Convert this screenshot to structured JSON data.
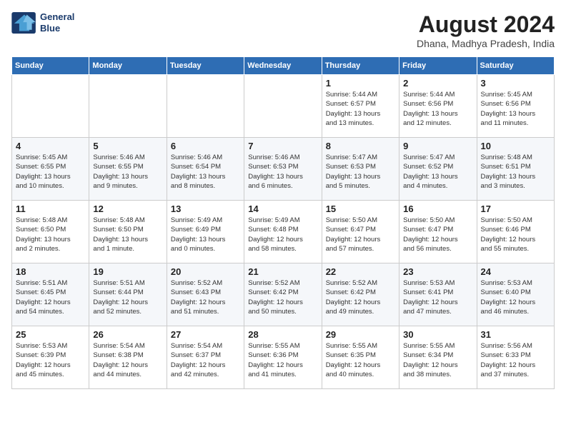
{
  "header": {
    "logo_line1": "General",
    "logo_line2": "Blue",
    "month_year": "August 2024",
    "location": "Dhana, Madhya Pradesh, India"
  },
  "weekdays": [
    "Sunday",
    "Monday",
    "Tuesday",
    "Wednesday",
    "Thursday",
    "Friday",
    "Saturday"
  ],
  "weeks": [
    [
      {
        "day": "",
        "info": ""
      },
      {
        "day": "",
        "info": ""
      },
      {
        "day": "",
        "info": ""
      },
      {
        "day": "",
        "info": ""
      },
      {
        "day": "1",
        "info": "Sunrise: 5:44 AM\nSunset: 6:57 PM\nDaylight: 13 hours\nand 13 minutes."
      },
      {
        "day": "2",
        "info": "Sunrise: 5:44 AM\nSunset: 6:56 PM\nDaylight: 13 hours\nand 12 minutes."
      },
      {
        "day": "3",
        "info": "Sunrise: 5:45 AM\nSunset: 6:56 PM\nDaylight: 13 hours\nand 11 minutes."
      }
    ],
    [
      {
        "day": "4",
        "info": "Sunrise: 5:45 AM\nSunset: 6:55 PM\nDaylight: 13 hours\nand 10 minutes."
      },
      {
        "day": "5",
        "info": "Sunrise: 5:46 AM\nSunset: 6:55 PM\nDaylight: 13 hours\nand 9 minutes."
      },
      {
        "day": "6",
        "info": "Sunrise: 5:46 AM\nSunset: 6:54 PM\nDaylight: 13 hours\nand 8 minutes."
      },
      {
        "day": "7",
        "info": "Sunrise: 5:46 AM\nSunset: 6:53 PM\nDaylight: 13 hours\nand 6 minutes."
      },
      {
        "day": "8",
        "info": "Sunrise: 5:47 AM\nSunset: 6:53 PM\nDaylight: 13 hours\nand 5 minutes."
      },
      {
        "day": "9",
        "info": "Sunrise: 5:47 AM\nSunset: 6:52 PM\nDaylight: 13 hours\nand 4 minutes."
      },
      {
        "day": "10",
        "info": "Sunrise: 5:48 AM\nSunset: 6:51 PM\nDaylight: 13 hours\nand 3 minutes."
      }
    ],
    [
      {
        "day": "11",
        "info": "Sunrise: 5:48 AM\nSunset: 6:50 PM\nDaylight: 13 hours\nand 2 minutes."
      },
      {
        "day": "12",
        "info": "Sunrise: 5:48 AM\nSunset: 6:50 PM\nDaylight: 13 hours\nand 1 minute."
      },
      {
        "day": "13",
        "info": "Sunrise: 5:49 AM\nSunset: 6:49 PM\nDaylight: 13 hours\nand 0 minutes."
      },
      {
        "day": "14",
        "info": "Sunrise: 5:49 AM\nSunset: 6:48 PM\nDaylight: 12 hours\nand 58 minutes."
      },
      {
        "day": "15",
        "info": "Sunrise: 5:50 AM\nSunset: 6:47 PM\nDaylight: 12 hours\nand 57 minutes."
      },
      {
        "day": "16",
        "info": "Sunrise: 5:50 AM\nSunset: 6:47 PM\nDaylight: 12 hours\nand 56 minutes."
      },
      {
        "day": "17",
        "info": "Sunrise: 5:50 AM\nSunset: 6:46 PM\nDaylight: 12 hours\nand 55 minutes."
      }
    ],
    [
      {
        "day": "18",
        "info": "Sunrise: 5:51 AM\nSunset: 6:45 PM\nDaylight: 12 hours\nand 54 minutes."
      },
      {
        "day": "19",
        "info": "Sunrise: 5:51 AM\nSunset: 6:44 PM\nDaylight: 12 hours\nand 52 minutes."
      },
      {
        "day": "20",
        "info": "Sunrise: 5:52 AM\nSunset: 6:43 PM\nDaylight: 12 hours\nand 51 minutes."
      },
      {
        "day": "21",
        "info": "Sunrise: 5:52 AM\nSunset: 6:42 PM\nDaylight: 12 hours\nand 50 minutes."
      },
      {
        "day": "22",
        "info": "Sunrise: 5:52 AM\nSunset: 6:42 PM\nDaylight: 12 hours\nand 49 minutes."
      },
      {
        "day": "23",
        "info": "Sunrise: 5:53 AM\nSunset: 6:41 PM\nDaylight: 12 hours\nand 47 minutes."
      },
      {
        "day": "24",
        "info": "Sunrise: 5:53 AM\nSunset: 6:40 PM\nDaylight: 12 hours\nand 46 minutes."
      }
    ],
    [
      {
        "day": "25",
        "info": "Sunrise: 5:53 AM\nSunset: 6:39 PM\nDaylight: 12 hours\nand 45 minutes."
      },
      {
        "day": "26",
        "info": "Sunrise: 5:54 AM\nSunset: 6:38 PM\nDaylight: 12 hours\nand 44 minutes."
      },
      {
        "day": "27",
        "info": "Sunrise: 5:54 AM\nSunset: 6:37 PM\nDaylight: 12 hours\nand 42 minutes."
      },
      {
        "day": "28",
        "info": "Sunrise: 5:55 AM\nSunset: 6:36 PM\nDaylight: 12 hours\nand 41 minutes."
      },
      {
        "day": "29",
        "info": "Sunrise: 5:55 AM\nSunset: 6:35 PM\nDaylight: 12 hours\nand 40 minutes."
      },
      {
        "day": "30",
        "info": "Sunrise: 5:55 AM\nSunset: 6:34 PM\nDaylight: 12 hours\nand 38 minutes."
      },
      {
        "day": "31",
        "info": "Sunrise: 5:56 AM\nSunset: 6:33 PM\nDaylight: 12 hours\nand 37 minutes."
      }
    ]
  ]
}
